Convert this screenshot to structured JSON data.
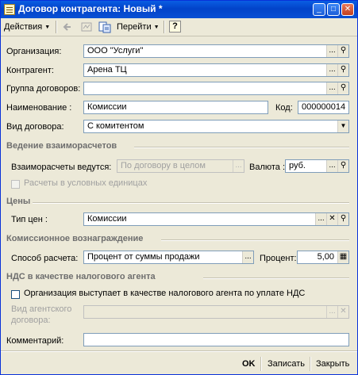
{
  "window": {
    "title": "Договор контрагента: Новый *",
    "min_glyph": "_",
    "max_glyph": "□",
    "close_glyph": "✕"
  },
  "toolbar": {
    "actions_label": "Действия",
    "goto_label": "Перейти",
    "help_glyph": "?"
  },
  "form": {
    "org_label": "Организация:",
    "org_value": "ООО \"Услуги\"",
    "contractor_label": "Контрагент:",
    "contractor_value": "Арена ТЦ",
    "group_label": "Группа договоров:",
    "group_value": "",
    "name_label": "Наименование :",
    "name_value": "Комиссии",
    "code_label": "Код:",
    "code_value": "000000014",
    "type_label": "Вид договора:",
    "type_value": "С комитентом"
  },
  "settlements": {
    "section_title": "Ведение взаиморасчетов",
    "mode_label": "Взаиморасчеты ведутся:",
    "mode_value": "По договору в целом",
    "currency_label": "Валюта :",
    "currency_value": "руб.",
    "conventional_units_label": "Расчеты в условных единицах"
  },
  "prices": {
    "section_title": "Цены",
    "price_type_label": "Тип цен :",
    "price_type_value": "Комиссии"
  },
  "commission": {
    "section_title": "Комиссионное вознаграждение",
    "method_label": "Способ расчета:",
    "method_value": "Процент от суммы продажи",
    "percent_label": "Процент:",
    "percent_value": "5,00"
  },
  "vat": {
    "section_title": "НДС в качестве налогового агента",
    "agent_checkbox_label": "Организация выступает в качестве налогового агента по уплате НДС",
    "agent_contract_label_line1": "Вид агентского",
    "agent_contract_label_line2": "договора:",
    "agent_contract_value": ""
  },
  "comment": {
    "label": "Комментарий:",
    "value": ""
  },
  "buttons": {
    "ok": "OK",
    "save": "Записать",
    "close": "Закрыть"
  },
  "glyphs": {
    "ellipsis": "...",
    "search": "⚲",
    "clear": "✕",
    "dropdown": "▼",
    "calc": "▦"
  }
}
